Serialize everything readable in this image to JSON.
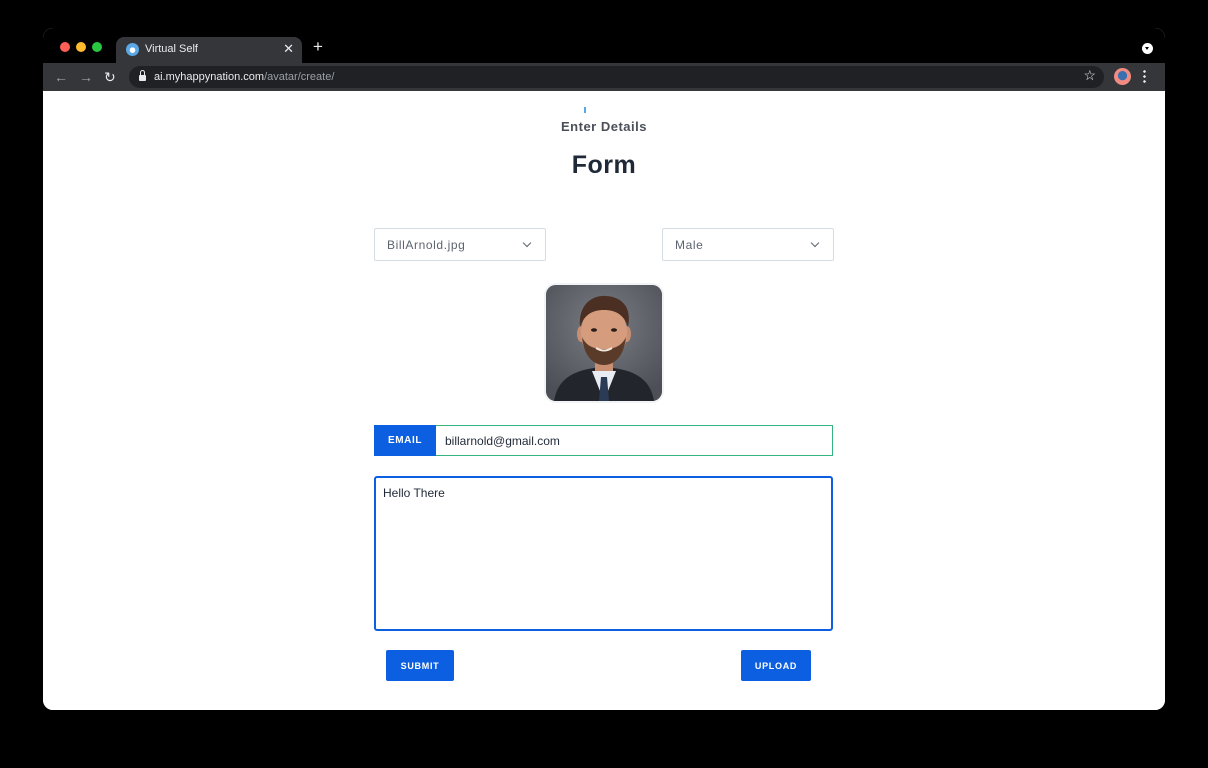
{
  "browser": {
    "tab": {
      "title": "Virtual Self",
      "close_glyph": "✕",
      "favicon": "globe-favicon"
    },
    "new_tab_glyph": "+",
    "toolbar": {
      "back_glyph": "←",
      "forward_glyph": "→",
      "reload_glyph": "↻",
      "url_host": "ai.myhappynation.com",
      "url_path": "/avatar/create/",
      "star_glyph": "☆"
    }
  },
  "page": {
    "step_label": "Enter Details",
    "form_title": "Form",
    "image_select": {
      "value": "BillArnold.jpg"
    },
    "gender_select": {
      "value": "Male"
    },
    "avatar": {
      "icon": "user-portrait"
    },
    "email": {
      "label": "EMAIL",
      "value": "billarnold@gmail.com"
    },
    "message": {
      "value": "Hello There"
    },
    "submit_label": "SUBMIT",
    "upload_label": "UPLOAD"
  },
  "colors": {
    "primary": "#0b5fe0",
    "email_border": "#36b37e",
    "tab_bg": "#35363a"
  }
}
